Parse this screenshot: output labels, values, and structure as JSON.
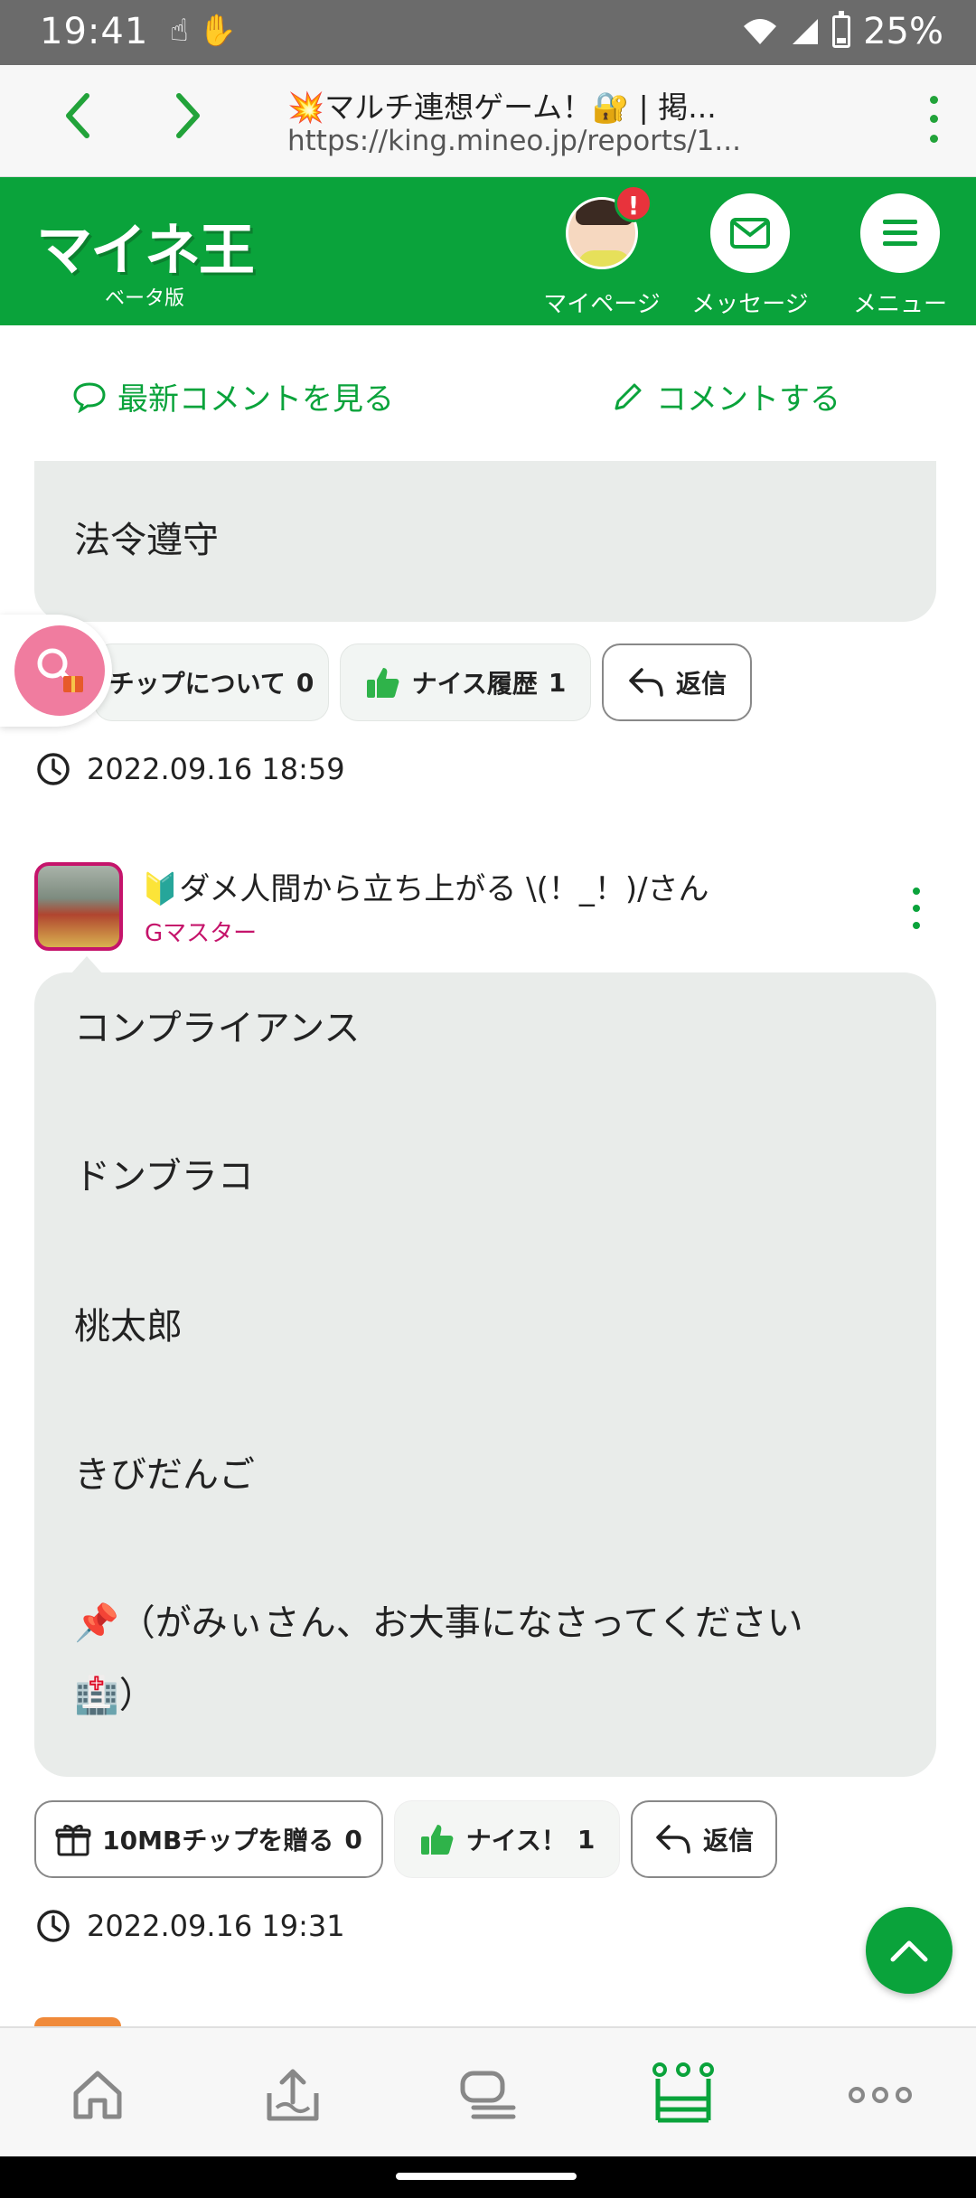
{
  "status_bar": {
    "time": "19:41",
    "battery": "25%"
  },
  "browser": {
    "title": "💥マルチ連想ゲーム！🔐 | 掲...",
    "url": "https://king.mineo.jp/reports/1..."
  },
  "header": {
    "logo": "マイネ王",
    "logo_sub": "ベータ版",
    "mypage_label": "マイページ",
    "mypage_badge": "!",
    "message_label": "メッセージ",
    "menu_label": "メニュー"
  },
  "actions": {
    "latest_comments": "最新コメントを見る",
    "post_comment": "コメントする"
  },
  "comment_prev": {
    "text": "法令遵守",
    "tip_button": "チップについて",
    "tip_count": "0",
    "nice_button": "ナイス履歴",
    "nice_count": "1",
    "reply_button": "返信",
    "timestamp": "2022.09.16 18:59"
  },
  "comment_main": {
    "user_name": "🔰ダメ人間から立ち上がる \\(！_！)/さん",
    "user_rank": "Gマスター",
    "lines": [
      "コンプライアンス",
      "ドンブラコ",
      "桃太郎",
      "きびだんご",
      "📌（がみぃさん、お大事になさってください",
      "🏥）"
    ],
    "tip_button": "10MBチップを贈る",
    "tip_count": "0",
    "nice_button": "ナイス！",
    "nice_count": "1",
    "reply_button": "返信",
    "timestamp": "2022.09.16 19:31"
  },
  "colors": {
    "brand_green": "#0aa33b",
    "rank_magenta": "#c5146b",
    "bubble_gray": "#e9ecea"
  },
  "tabs": [
    "home-icon",
    "upload-icon",
    "forum-icon",
    "king-crown-icon",
    "more-icon"
  ]
}
